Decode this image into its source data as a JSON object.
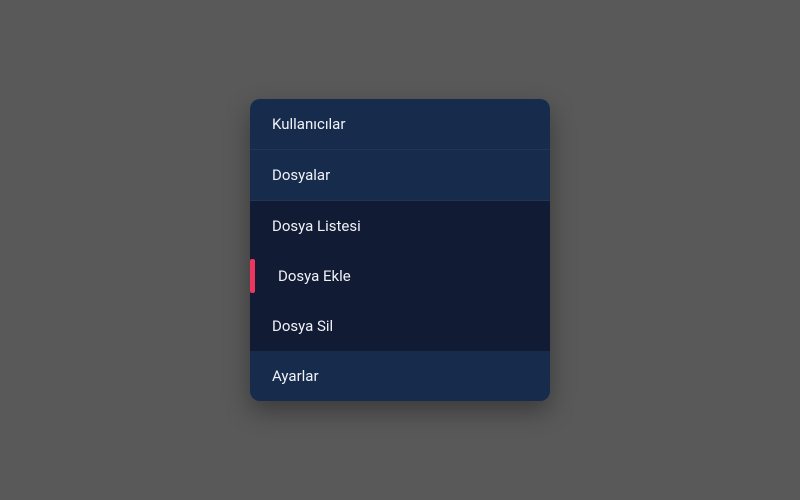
{
  "menu": {
    "items": [
      {
        "label": "Kullanıcılar"
      },
      {
        "label": "Dosyalar"
      }
    ],
    "submenu": [
      {
        "label": "Dosya Listesi"
      },
      {
        "label": "Dosya Ekle"
      },
      {
        "label": "Dosya Sil"
      }
    ],
    "footer": [
      {
        "label": "Ayarlar"
      }
    ]
  }
}
